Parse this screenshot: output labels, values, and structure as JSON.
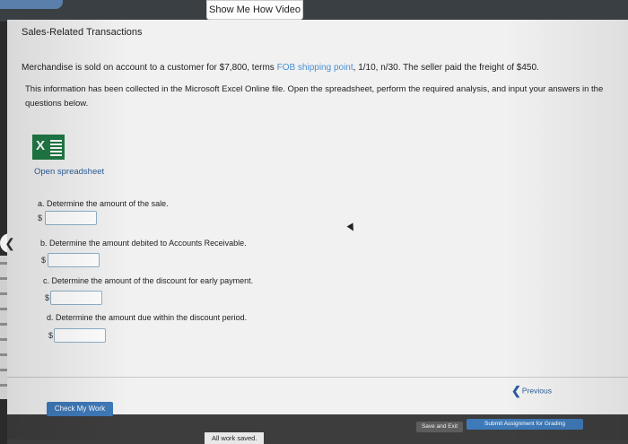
{
  "header": {
    "show_video_label": "Show Me How Video"
  },
  "problem": {
    "title": "Sales-Related Transactions",
    "line1_start": "Merchandise is sold on account to a customer for $7,800, terms ",
    "line1_blue": "FOB shipping point",
    "line1_end": ", 1/10, n/30. The seller paid the freight of $450.",
    "line2": "This information has been collected in the Microsoft Excel Online file. Open the spreadsheet, perform the required analysis, and input your answers in the questions below.",
    "open_spreadsheet": "Open spreadsheet",
    "excel_icon": "excel-icon"
  },
  "questions": [
    {
      "label": "a. Determine the amount of the sale.",
      "currency": "$",
      "value": ""
    },
    {
      "label": "b. Determine the amount debited to Accounts Receivable.",
      "currency": "$",
      "value": ""
    },
    {
      "label": "c. Determine the amount of the discount for early payment.",
      "currency": "$",
      "value": ""
    },
    {
      "label": "d. Determine the amount due within the discount period.",
      "currency": "$",
      "value": ""
    }
  ],
  "nav": {
    "previous": "Previous",
    "back_icon": "chevron-left-icon"
  },
  "footer": {
    "check_work": "Check My Work",
    "save_exit": "Save and Exit",
    "submit": "Submit Assignment for Grading",
    "status": "All work saved."
  },
  "colors": {
    "accent": "#3e79b8",
    "link": "#2a5c9a",
    "excel": "#1f7a45",
    "terms_highlight": "#4a8fd0"
  }
}
